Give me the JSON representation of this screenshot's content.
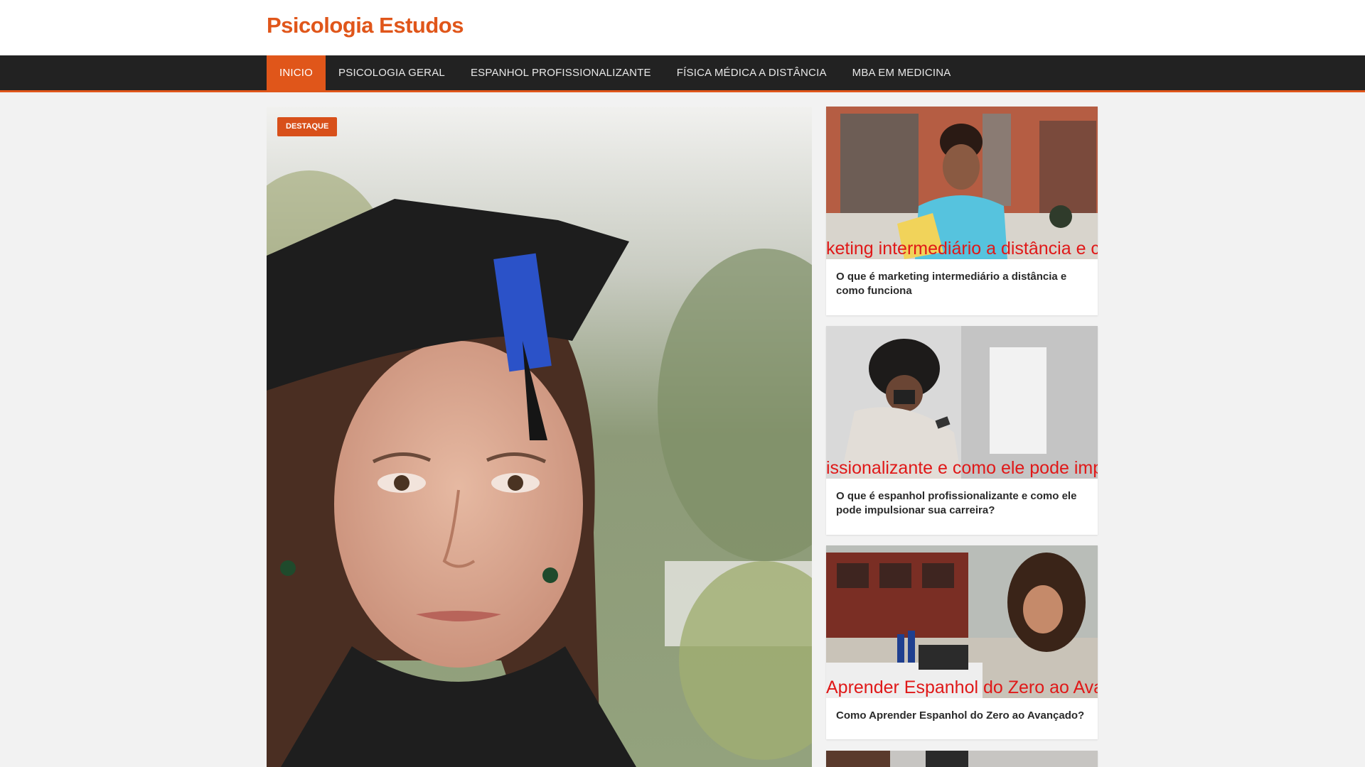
{
  "site": {
    "title": "Psicologia Estudos"
  },
  "nav": {
    "items": [
      {
        "label": "Inicio",
        "active": true
      },
      {
        "label": "Psicologia Geral"
      },
      {
        "label": "Espanhol Profissionalizante"
      },
      {
        "label": "Física Médica a Distância"
      },
      {
        "label": "MBA em Medicina"
      }
    ]
  },
  "featured": {
    "badge": "Destaque"
  },
  "posts": [
    {
      "thumb_caption": "keting intermediário a distância e c",
      "title": "O que é marketing intermediário a distância e como funciona"
    },
    {
      "thumb_caption": "issionalizante e como ele pode imp",
      "title": "O que é espanhol profissionalizante e como ele pode impulsionar sua carreira?"
    },
    {
      "thumb_caption": "Aprender Espanhol do Zero ao Ava",
      "title": "Como Aprender Espanhol do Zero ao Avançado?"
    }
  ],
  "colors": {
    "accent": "#e0561a",
    "nav_bg": "#222222",
    "caption_red": "#e01818"
  }
}
